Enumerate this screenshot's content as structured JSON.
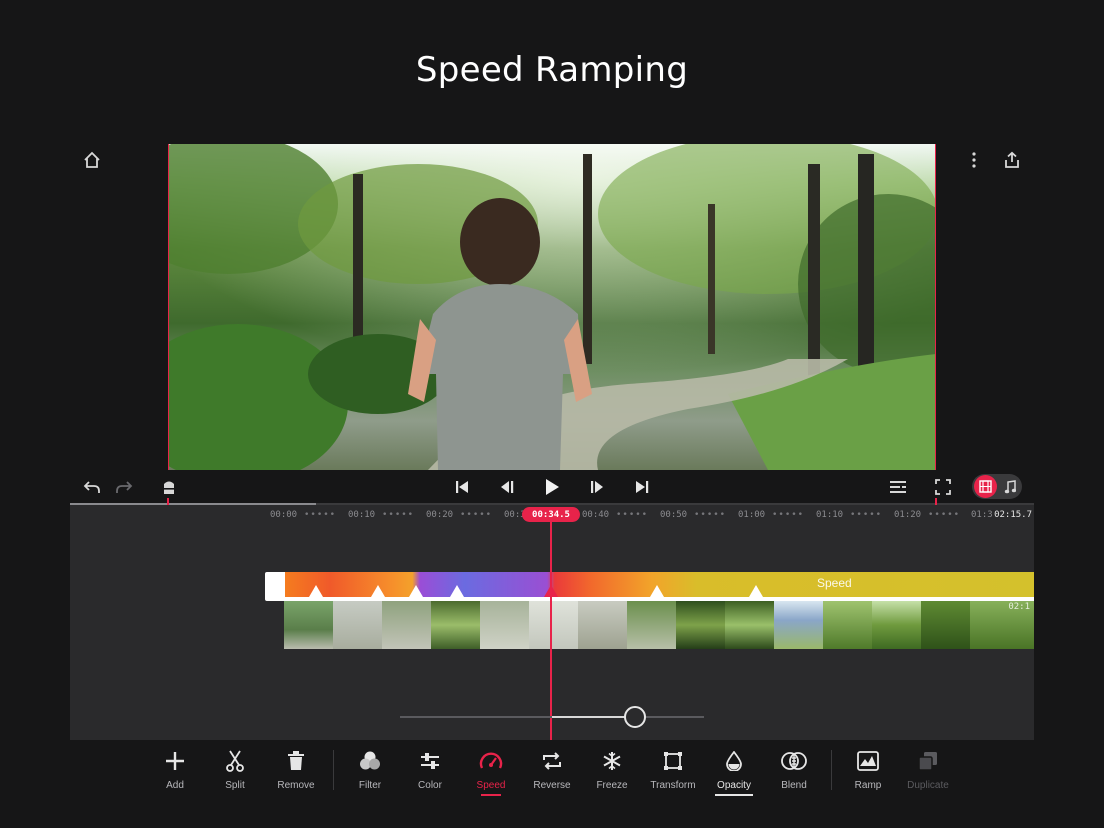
{
  "headline": "Speed Ramping",
  "colors": {
    "accent": "#e8234a",
    "background": "#161617",
    "panel": "#2a2a2c"
  },
  "top_icons": {
    "home": "home-icon",
    "more": "more-vertical-icon",
    "share": "share-icon"
  },
  "playback": {
    "undo": "undo-icon",
    "redo": "redo-icon",
    "split_marker": "marker-icon",
    "skip_start": "skip-start-icon",
    "step_back": "frame-back-icon",
    "play": "play-icon",
    "step_forward": "frame-forward-icon",
    "skip_end": "skip-end-icon",
    "list": "track-list-icon",
    "fullscreen": "fullscreen-icon",
    "video_track": "film-icon",
    "audio_track": "music-note-icon"
  },
  "timeline": {
    "ticks": [
      "00:00",
      "00:10",
      "00:20",
      "00:3",
      "00:40",
      "00:50",
      "01:00",
      "01:10",
      "01:20",
      "01:3"
    ],
    "playhead_time": "00:34.5",
    "duration": "02:15.7",
    "speed_label": "Speed",
    "frame_time": "02:1",
    "speed_slider_value": 0.77
  },
  "toolbar": [
    {
      "label": "Add",
      "icon": "plus-icon"
    },
    {
      "label": "Split",
      "icon": "scissors-icon"
    },
    {
      "label": "Remove",
      "icon": "trash-icon"
    },
    {
      "label": "Filter",
      "icon": "filter-icon"
    },
    {
      "label": "Color",
      "icon": "sliders-icon"
    },
    {
      "label": "Speed",
      "icon": "speedometer-icon",
      "state": "selected"
    },
    {
      "label": "Reverse",
      "icon": "reverse-icon"
    },
    {
      "label": "Freeze",
      "icon": "snowflake-icon"
    },
    {
      "label": "Transform",
      "icon": "transform-icon"
    },
    {
      "label": "Opacity",
      "icon": "drop-icon",
      "state": "underlined"
    },
    {
      "label": "Blend",
      "icon": "blend-icon"
    },
    {
      "label": "Ramp",
      "icon": "ramp-icon"
    },
    {
      "label": "Duplicate",
      "icon": "duplicate-icon",
      "state": "disabled"
    }
  ]
}
